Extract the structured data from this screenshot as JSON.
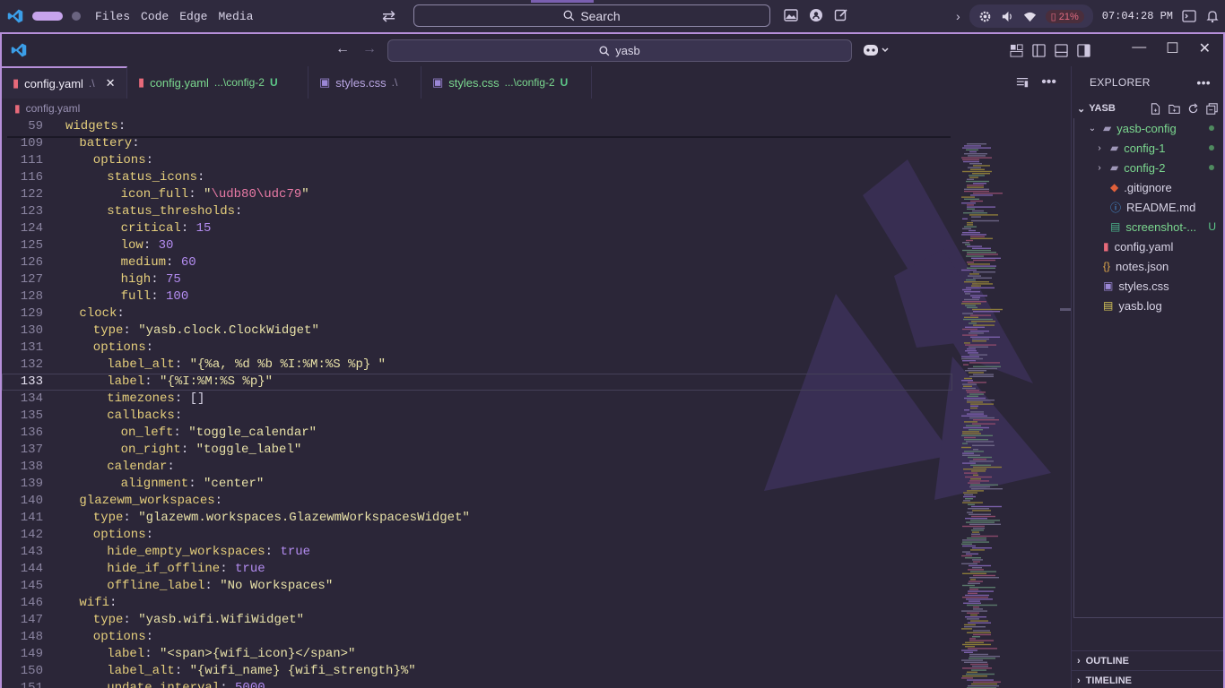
{
  "taskbar": {
    "menu": [
      "Files",
      "Code",
      "Edge",
      "Media"
    ],
    "search_label": "Search",
    "battery": "21%",
    "clock": "07:04:28 PM"
  },
  "titlebar": {
    "command_center_text": "yasb"
  },
  "tabs": [
    {
      "name": "config.yaml",
      "path": ".\\",
      "badge": "",
      "style": "active"
    },
    {
      "name": "config.yaml",
      "path": "...\\config-2",
      "badge": "U",
      "style": "green"
    },
    {
      "name": "styles.css",
      "path": ".\\",
      "badge": "",
      "style": "purple"
    },
    {
      "name": "styles.css",
      "path": "...\\config-2",
      "badge": "U",
      "style": "green"
    }
  ],
  "breadcrumb": "config.yaml",
  "code_lines": [
    {
      "n": "59",
      "i": 0,
      "parts": [
        [
          "k",
          "widgets"
        ],
        [
          "p",
          ":"
        ]
      ]
    },
    {
      "n": "109",
      "i": 1,
      "parts": [
        [
          "k",
          "battery"
        ],
        [
          "p",
          ":"
        ]
      ]
    },
    {
      "n": "111",
      "i": 2,
      "parts": [
        [
          "k",
          "options"
        ],
        [
          "p",
          ":"
        ]
      ]
    },
    {
      "n": "116",
      "i": 3,
      "parts": [
        [
          "k",
          "status_icons"
        ],
        [
          "p",
          ":"
        ]
      ]
    },
    {
      "n": "122",
      "i": 4,
      "parts": [
        [
          "k",
          "icon_full"
        ],
        [
          "p",
          ": "
        ],
        [
          "s",
          "\""
        ],
        [
          "esc",
          "\\udb80\\udc79"
        ],
        [
          "s",
          "\""
        ]
      ]
    },
    {
      "n": "123",
      "i": 3,
      "parts": [
        [
          "k",
          "status_thresholds"
        ],
        [
          "p",
          ":"
        ]
      ]
    },
    {
      "n": "124",
      "i": 4,
      "parts": [
        [
          "k",
          "critical"
        ],
        [
          "p",
          ": "
        ],
        [
          "n",
          "15"
        ]
      ]
    },
    {
      "n": "125",
      "i": 4,
      "parts": [
        [
          "k",
          "low"
        ],
        [
          "p",
          ": "
        ],
        [
          "n",
          "30"
        ]
      ]
    },
    {
      "n": "126",
      "i": 4,
      "parts": [
        [
          "k",
          "medium"
        ],
        [
          "p",
          ": "
        ],
        [
          "n",
          "60"
        ]
      ]
    },
    {
      "n": "127",
      "i": 4,
      "parts": [
        [
          "k",
          "high"
        ],
        [
          "p",
          ": "
        ],
        [
          "n",
          "75"
        ]
      ]
    },
    {
      "n": "128",
      "i": 4,
      "parts": [
        [
          "k",
          "full"
        ],
        [
          "p",
          ": "
        ],
        [
          "n",
          "100"
        ]
      ]
    },
    {
      "n": "129",
      "i": 1,
      "parts": [
        [
          "k",
          "clock"
        ],
        [
          "p",
          ":"
        ]
      ]
    },
    {
      "n": "130",
      "i": 2,
      "parts": [
        [
          "k",
          "type"
        ],
        [
          "p",
          ": "
        ],
        [
          "s",
          "\"yasb.clock.ClockWidget\""
        ]
      ]
    },
    {
      "n": "131",
      "i": 2,
      "parts": [
        [
          "k",
          "options"
        ],
        [
          "p",
          ":"
        ]
      ]
    },
    {
      "n": "132",
      "i": 3,
      "parts": [
        [
          "k",
          "label_alt"
        ],
        [
          "p",
          ": "
        ],
        [
          "s",
          "\"{%a, %d %b %I:%M:%S %p} \""
        ]
      ]
    },
    {
      "n": "133",
      "i": 3,
      "cur": true,
      "parts": [
        [
          "k",
          "label"
        ],
        [
          "p",
          ": "
        ],
        [
          "s",
          "\"{%I:%M:%S %p}\""
        ]
      ]
    },
    {
      "n": "134",
      "i": 3,
      "parts": [
        [
          "k",
          "timezones"
        ],
        [
          "p",
          ": []"
        ]
      ]
    },
    {
      "n": "135",
      "i": 3,
      "parts": [
        [
          "k",
          "callbacks"
        ],
        [
          "p",
          ":"
        ]
      ]
    },
    {
      "n": "136",
      "i": 4,
      "parts": [
        [
          "k",
          "on_left"
        ],
        [
          "p",
          ": "
        ],
        [
          "s",
          "\"toggle_calendar\""
        ]
      ]
    },
    {
      "n": "137",
      "i": 4,
      "parts": [
        [
          "k",
          "on_right"
        ],
        [
          "p",
          ": "
        ],
        [
          "s",
          "\"toggle_label\""
        ]
      ]
    },
    {
      "n": "138",
      "i": 3,
      "parts": [
        [
          "k",
          "calendar"
        ],
        [
          "p",
          ":"
        ]
      ]
    },
    {
      "n": "139",
      "i": 4,
      "parts": [
        [
          "k",
          "alignment"
        ],
        [
          "p",
          ": "
        ],
        [
          "s",
          "\"center\""
        ]
      ]
    },
    {
      "n": "140",
      "i": 1,
      "parts": [
        [
          "k",
          "glazewm_workspaces"
        ],
        [
          "p",
          ":"
        ]
      ]
    },
    {
      "n": "141",
      "i": 2,
      "parts": [
        [
          "k",
          "type"
        ],
        [
          "p",
          ": "
        ],
        [
          "s",
          "\"glazewm.workspaces.GlazewmWorkspacesWidget\""
        ]
      ]
    },
    {
      "n": "142",
      "i": 2,
      "parts": [
        [
          "k",
          "options"
        ],
        [
          "p",
          ":"
        ]
      ]
    },
    {
      "n": "143",
      "i": 3,
      "parts": [
        [
          "k",
          "hide_empty_workspaces"
        ],
        [
          "p",
          ": "
        ],
        [
          "t",
          "true"
        ]
      ]
    },
    {
      "n": "144",
      "i": 3,
      "parts": [
        [
          "k",
          "hide_if_offline"
        ],
        [
          "p",
          ": "
        ],
        [
          "t",
          "true"
        ]
      ]
    },
    {
      "n": "145",
      "i": 3,
      "parts": [
        [
          "k",
          "offline_label"
        ],
        [
          "p",
          ": "
        ],
        [
          "s",
          "\"No Workspaces\""
        ]
      ]
    },
    {
      "n": "146",
      "i": 1,
      "parts": [
        [
          "k",
          "wifi"
        ],
        [
          "p",
          ":"
        ]
      ]
    },
    {
      "n": "147",
      "i": 2,
      "parts": [
        [
          "k",
          "type"
        ],
        [
          "p",
          ": "
        ],
        [
          "s",
          "\"yasb.wifi.WifiWidget\""
        ]
      ]
    },
    {
      "n": "148",
      "i": 2,
      "parts": [
        [
          "k",
          "options"
        ],
        [
          "p",
          ":"
        ]
      ]
    },
    {
      "n": "149",
      "i": 3,
      "parts": [
        [
          "k",
          "label"
        ],
        [
          "p",
          ": "
        ],
        [
          "s",
          "\"<span>{wifi_icon}</span>\""
        ]
      ]
    },
    {
      "n": "150",
      "i": 3,
      "parts": [
        [
          "k",
          "label_alt"
        ],
        [
          "p",
          ": "
        ],
        [
          "s",
          "\"{wifi_name} {wifi_strength}%\""
        ]
      ]
    },
    {
      "n": "151",
      "i": 3,
      "parts": [
        [
          "k",
          "update_interval"
        ],
        [
          "p",
          ": "
        ],
        [
          "n",
          "5000"
        ]
      ]
    }
  ],
  "explorer": {
    "title": "EXPLORER",
    "root": "YASB",
    "items": [
      {
        "label": "yasb-config",
        "kind": "folder-open",
        "depth": 0,
        "chev": "v",
        "status": "dot",
        "color": "green"
      },
      {
        "label": "config-1",
        "kind": "folder",
        "depth": 1,
        "chev": ">",
        "status": "dot",
        "color": "green"
      },
      {
        "label": "config-2",
        "kind": "folder",
        "depth": 1,
        "chev": ">",
        "status": "dot",
        "color": "green"
      },
      {
        "label": ".gitignore",
        "kind": "git",
        "depth": 1,
        "chev": "",
        "status": "",
        "color": ""
      },
      {
        "label": "README.md",
        "kind": "info",
        "depth": 1,
        "chev": "",
        "status": "",
        "color": ""
      },
      {
        "label": "screenshot-...",
        "kind": "image",
        "depth": 1,
        "chev": "",
        "status": "U",
        "color": "green"
      },
      {
        "label": "config.yaml",
        "kind": "yaml",
        "depth": 0,
        "chev": "",
        "status": "",
        "color": ""
      },
      {
        "label": "notes.json",
        "kind": "json",
        "depth": 0,
        "chev": "",
        "status": "",
        "color": ""
      },
      {
        "label": "styles.css",
        "kind": "css",
        "depth": 0,
        "chev": "",
        "status": "",
        "color": ""
      },
      {
        "label": "yasb.log",
        "kind": "log",
        "depth": 0,
        "chev": "",
        "status": "",
        "color": ""
      }
    ],
    "outline": "OUTLINE",
    "timeline": "TIMELINE"
  },
  "colors": {
    "accent": "#b68fd9",
    "git_added": "#5dc989"
  }
}
